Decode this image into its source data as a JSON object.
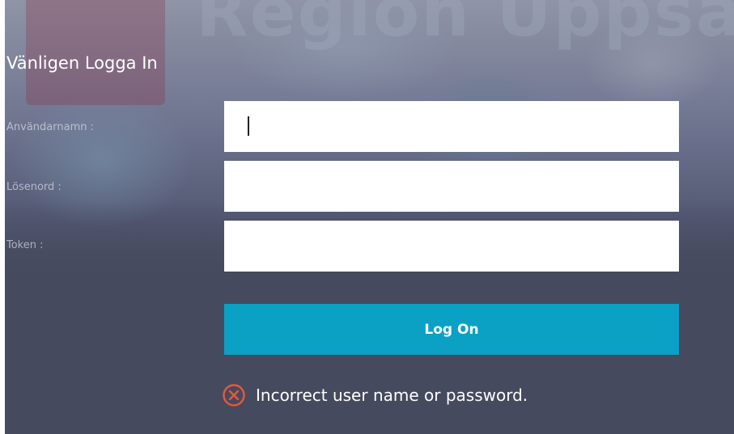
{
  "brand": {
    "logo_text": "Region Uppsala"
  },
  "login": {
    "heading": "Vänligen Logga In",
    "username_label": "Användarnamn :",
    "password_label": "Lösenord :",
    "token_label": "Token :",
    "username_value": "",
    "password_value": "",
    "token_value": "",
    "submit_label": "Log On"
  },
  "error": {
    "icon": "error-circle-x-icon",
    "message": "Incorrect user name or password.",
    "color": "#e8573a"
  },
  "colors": {
    "button": "#0aa1c4",
    "panel": "#464a5e"
  }
}
